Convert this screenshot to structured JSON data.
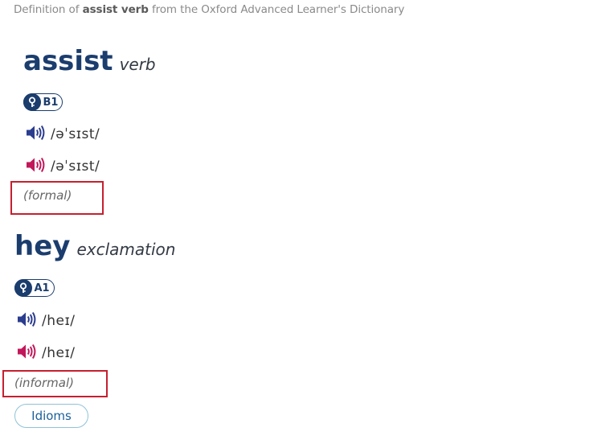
{
  "caption": {
    "prefix": "Definition of",
    "term": "assist verb",
    "suffix": "from the Oxford Advanced Learner's Dictionary"
  },
  "entries": [
    {
      "headword": "assist",
      "part_of_speech": "verb",
      "level": "B1",
      "pronunciations": [
        {
          "variant": "british",
          "icon": "speaker-icon-blue",
          "ipa": "/əˈsɪst/"
        },
        {
          "variant": "american",
          "icon": "speaker-icon-red",
          "ipa": "/əˈsɪst/"
        }
      ],
      "register": "(formal)"
    },
    {
      "headword": "hey",
      "part_of_speech": "exclamation",
      "level": "A1",
      "pronunciations": [
        {
          "variant": "british",
          "icon": "speaker-icon-blue",
          "ipa": "/heɪ/"
        },
        {
          "variant": "american",
          "icon": "speaker-icon-red",
          "ipa": "/heɪ/"
        }
      ],
      "register": "(informal)"
    }
  ],
  "idioms_button": "Idioms",
  "colors": {
    "brand_blue": "#1b3d6e",
    "speaker_blue": "#2b3d8f",
    "speaker_red": "#c2185b",
    "highlight_red": "#c6202f",
    "idioms_border": "#8fc3d6"
  }
}
